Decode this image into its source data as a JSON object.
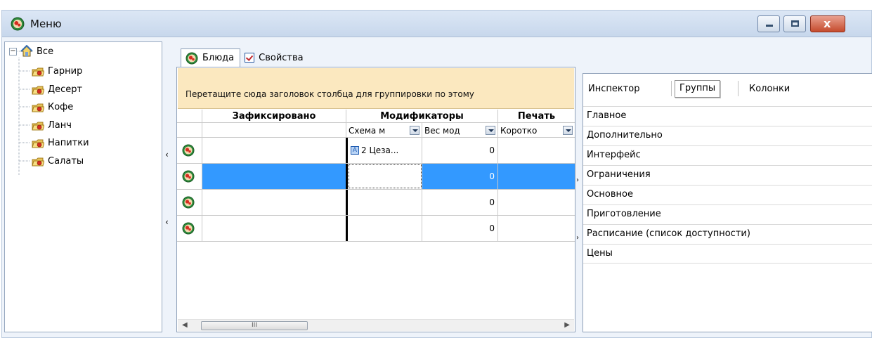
{
  "window": {
    "title": "Меню"
  },
  "tree": {
    "root": "Все",
    "items": [
      "Гарнир",
      "Десерт",
      "Кофе",
      "Ланч",
      "Напитки",
      "Салаты"
    ]
  },
  "tabs": [
    {
      "label": "Блюда",
      "active": true,
      "icon": "dish-icon"
    },
    {
      "label": "Свойства",
      "active": false,
      "icon": "properties-checkbox-icon"
    }
  ],
  "grid": {
    "group_hint": "Перетащите сюда заголовок столбца для группировки по этому",
    "bands": [
      "Зафиксировано",
      "Модификаторы",
      "Печать"
    ],
    "columns": [
      "Схема м",
      "Вес мод",
      "Коротко"
    ],
    "rows": [
      {
        "scheme": "2 Цеза...",
        "weight": "0",
        "short": ""
      },
      {
        "scheme": "",
        "weight": "0",
        "short": ""
      },
      {
        "scheme": "",
        "weight": "0",
        "short": ""
      },
      {
        "scheme": "",
        "weight": "0",
        "short": ""
      }
    ],
    "scroll_thumb": "III"
  },
  "inspector": {
    "tabs": [
      "Инспектор",
      "Группы",
      "Колонки"
    ],
    "active_tab": "Группы",
    "groups": [
      "Главное",
      "Дополнительно",
      "Интерфейс",
      "Ограничения",
      "Основное",
      "Приготовление",
      "Расписание (список доступности)",
      "Цены"
    ]
  },
  "colors": {
    "selection": "#3399ff",
    "group_panel": "#fbe8bf",
    "close_button": "#c54b2d"
  }
}
